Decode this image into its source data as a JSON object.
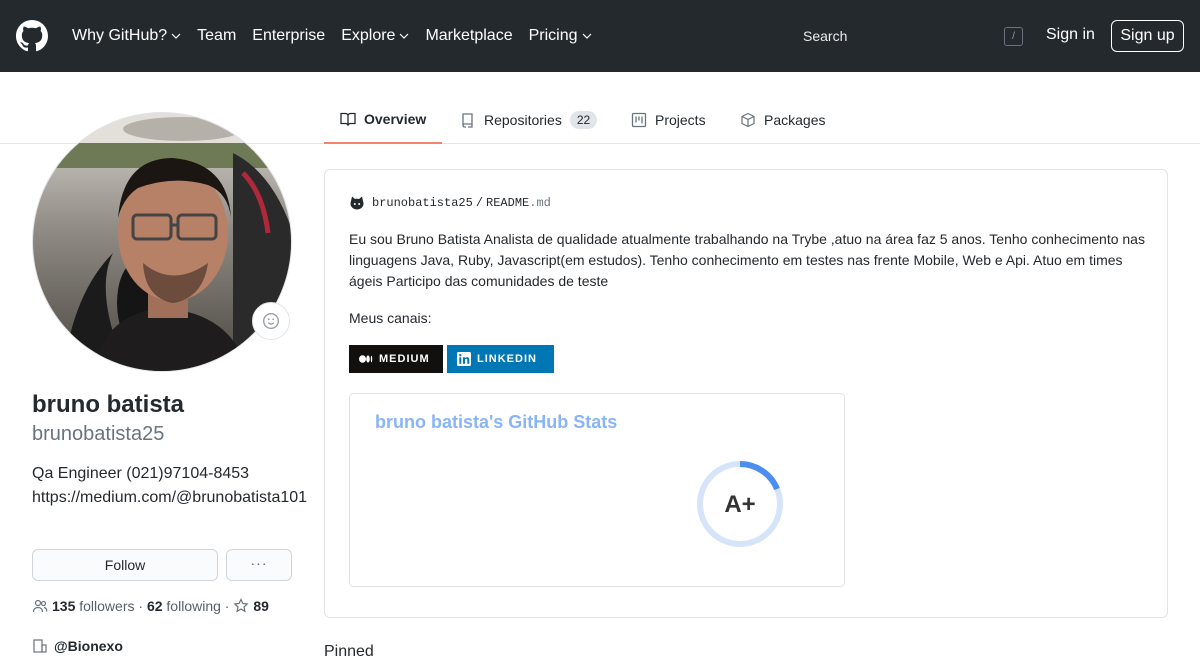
{
  "header": {
    "nav": [
      {
        "label": "Why GitHub?",
        "caret": true
      },
      {
        "label": "Team",
        "caret": false
      },
      {
        "label": "Enterprise",
        "caret": false
      },
      {
        "label": "Explore",
        "caret": true
      },
      {
        "label": "Marketplace",
        "caret": false
      },
      {
        "label": "Pricing",
        "caret": true
      }
    ],
    "search_placeholder": "Search",
    "search_shortcut": "/",
    "sign_in": "Sign in",
    "sign_up": "Sign up"
  },
  "tabs": [
    {
      "label": "Overview",
      "selected": true,
      "icon": "book-icon"
    },
    {
      "label": "Repositories",
      "count": "22",
      "icon": "repo-icon"
    },
    {
      "label": "Projects",
      "icon": "project-icon"
    },
    {
      "label": "Packages",
      "icon": "package-icon"
    }
  ],
  "profile": {
    "name": "bruno batista",
    "username": "brunobatista25",
    "bio": "Qa Engineer (021)97104-8453 https://medium.com/@brunobatista101",
    "follow_label": "Follow",
    "more_label": "···",
    "followers_count": "135",
    "followers_label": "followers",
    "following_count": "62",
    "following_label": "following",
    "stars_count": "89",
    "organization": "@Bionexo"
  },
  "readme": {
    "owner": "brunobatista25",
    "separator": "/",
    "file_name": "README",
    "file_ext": ".md",
    "paragraph": "Eu sou Bruno Batista Analista de qualidade atualmente trabalhando na Trybe ,atuo na área faz 5 anos. Tenho conhecimento nas linguagens Java, Ruby, Javascript(em estudos). Tenho conhecimento em testes nas frente Mobile, Web e Api. Atuo em times ágeis Participo das comunidades de teste",
    "channels_label": "Meus canais:",
    "badges": [
      {
        "label": "MEDIUM",
        "color": "#12100e"
      },
      {
        "label": "LINKEDIN",
        "color": "#0077b5"
      }
    ],
    "stats_card": {
      "title": "bruno batista's GitHub Stats",
      "grade": "A+",
      "title_color": "#89b4f7"
    }
  },
  "bottom_label": "Pinned",
  "colors": {
    "header_bg": "#24292e",
    "tab_underline": "#f9826c"
  }
}
